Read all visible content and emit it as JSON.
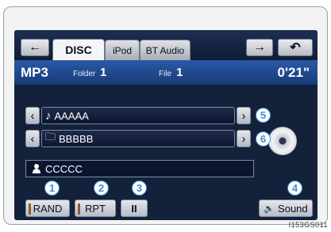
{
  "topbar": {
    "back_icon": "arrow-left-icon",
    "tabs": [
      {
        "label": "DISC",
        "active": true
      },
      {
        "label": "iPod",
        "active": false
      },
      {
        "label": "BT Audio",
        "active": false
      }
    ],
    "forward_icon": "arrow-right-icon",
    "return_icon": "return-icon"
  },
  "header": {
    "mode": "MP3",
    "folder_label": "Folder",
    "folder_value": "1",
    "file_label": "File",
    "file_value": "1",
    "time": "0'21\""
  },
  "rows": {
    "track": {
      "icon": "music-note-icon",
      "text": "AAAAA",
      "callout": "5"
    },
    "folder": {
      "icon": "folder-icon",
      "text": "BBBBB",
      "callout": "6"
    },
    "artist": {
      "icon": "person-icon",
      "text": "CCCCC"
    }
  },
  "buttons": {
    "rand": {
      "label": "RAND",
      "callout": "1"
    },
    "rpt": {
      "label": "RPT",
      "callout": "2"
    },
    "pause": {
      "label": "II",
      "callout": "3"
    },
    "sound": {
      "label": "Sound",
      "icon": "speaker-icon",
      "callout": "4"
    }
  },
  "figure_code": "I153GS011",
  "colors": {
    "callout": "#3a8ed8",
    "header": "#2a5aa6",
    "screen": "#14213b"
  }
}
